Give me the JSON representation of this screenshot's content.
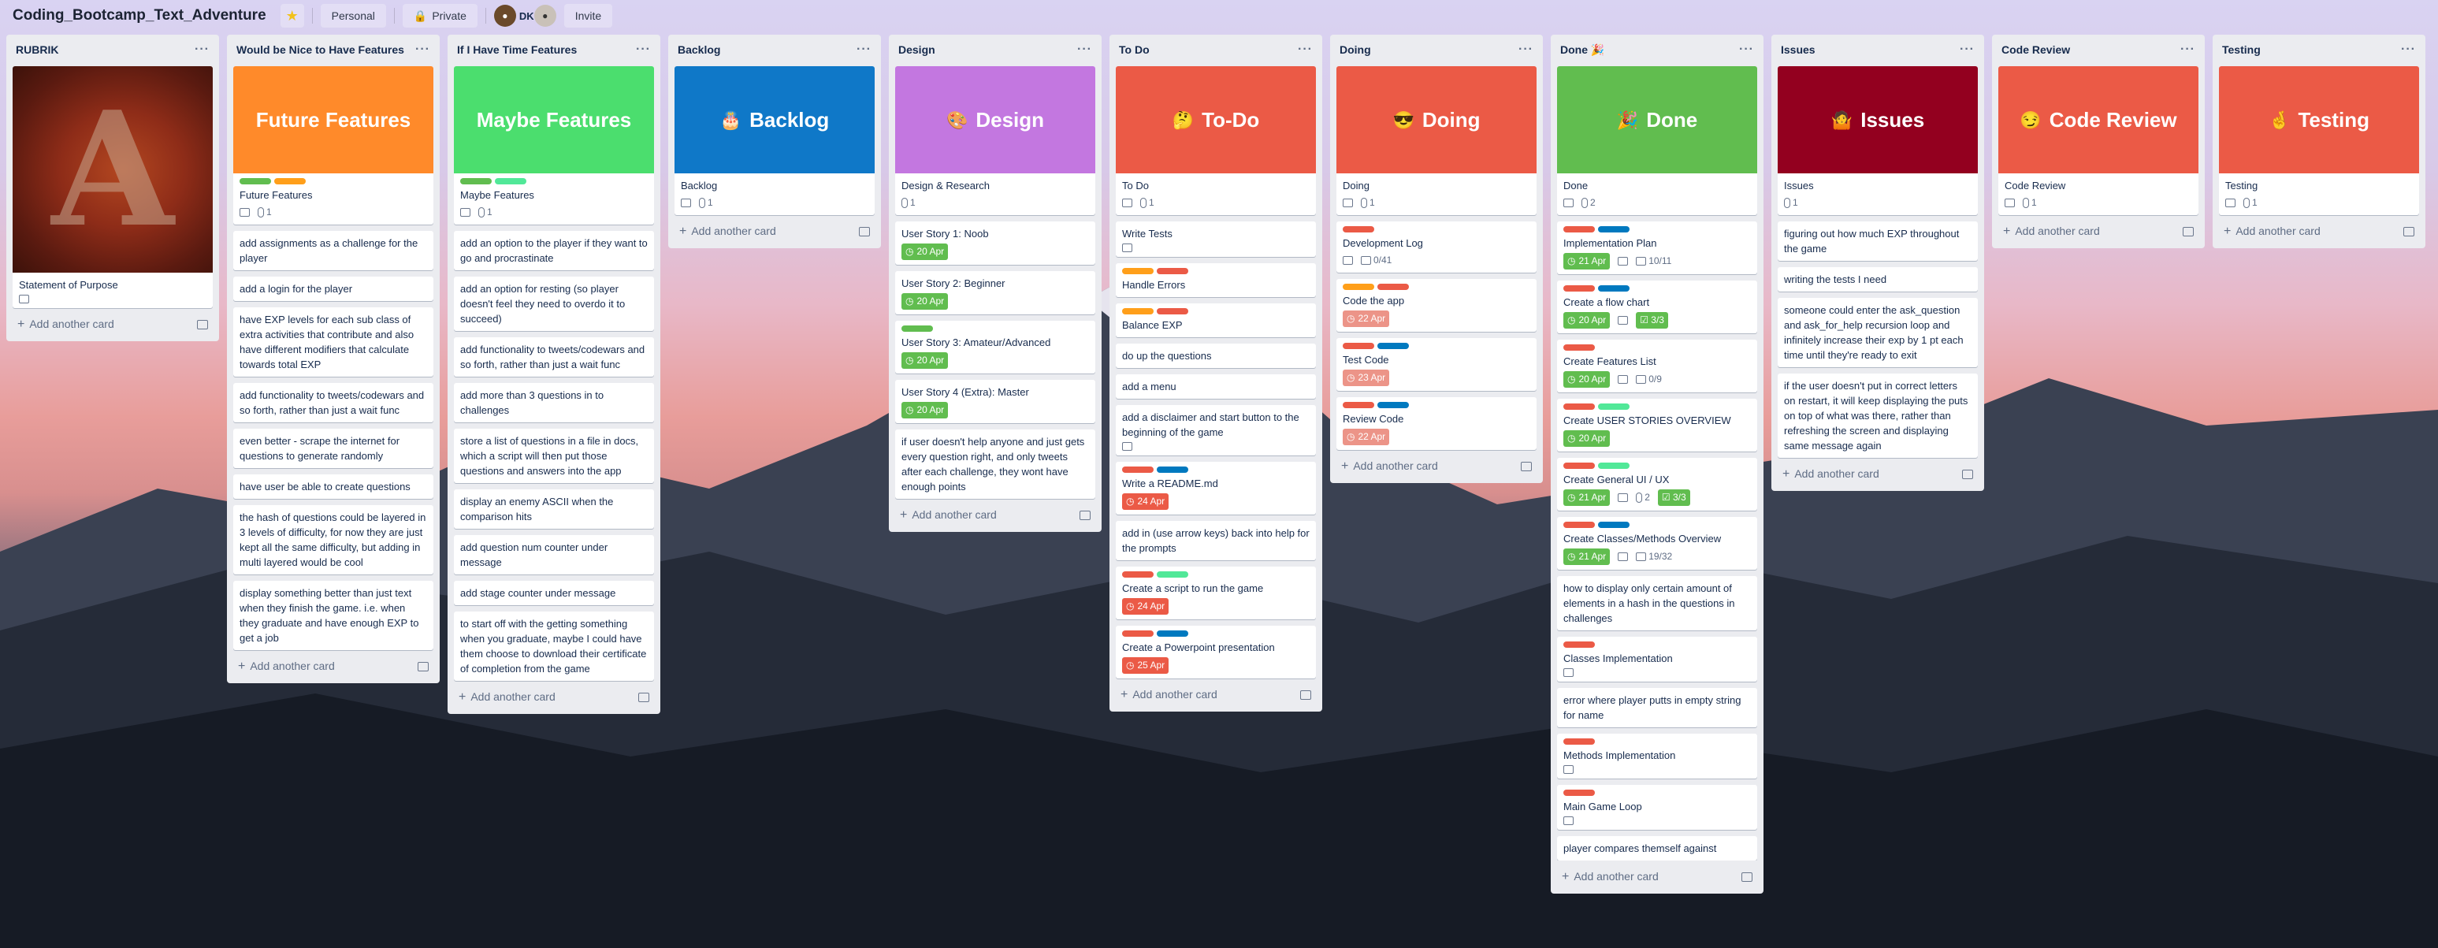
{
  "board": {
    "title": "Coding_Bootcamp_Text_Adventure",
    "visibility_team": "Personal",
    "visibility": "Private",
    "member_initials": "DK",
    "invite_label": "Invite"
  },
  "lists": {
    "rubrik": {
      "title": "RUBRIK",
      "add": "Add another card",
      "cards": {
        "c1": "Statement of Purpose"
      },
      "cover_letter": "A"
    },
    "nice": {
      "title": "Would be Nice to Have Features",
      "add": "Add another card",
      "cover": "Future Features",
      "cards": {
        "c1": "Future Features",
        "c1_att": "1",
        "c2": "add assignments as a challenge for the player",
        "c3": "add a login for the player",
        "c4": "have EXP levels for each sub class of extra activities that contribute and also have different modifiers that calculate towards total EXP",
        "c5": "add functionality to tweets/codewars and so forth, rather than just a wait func",
        "c6": "even better - scrape the internet for questions to generate randomly",
        "c7": "have user be able to create questions",
        "c8": "the hash of questions could be layered in 3 levels of difficulty, for now they are just kept all the same difficulty, but adding in multi layered would be cool",
        "c9": "display something better than just text when they finish the game. i.e. when they graduate and have enough EXP to get a job"
      }
    },
    "maybe": {
      "title": "If I Have Time Features",
      "add": "Add another card",
      "cover": "Maybe Features",
      "cards": {
        "c1": "Maybe Features",
        "c1_att": "1",
        "c2": "add an option to the player if they want to go and procrastinate",
        "c3": "add an option for resting (so player doesn't feel they need to overdo it to succeed)",
        "c4": "add functionality to tweets/codewars and so forth, rather than just a wait func",
        "c5": "add more than 3 questions in to challenges",
        "c6": "store a list of questions in a file in docs, which a script will then put those questions and answers into the app",
        "c7": "display an enemy ASCII when the comparison hits",
        "c8": "add question num counter under message",
        "c9": "add stage counter under message",
        "c10": "to start off with the getting something when you graduate, maybe I could have them choose to download their certificate of completion from the game"
      }
    },
    "backlog": {
      "title": "Backlog",
      "add": "Add another card",
      "cover": "Backlog",
      "cover_emoji": "🎂",
      "cards": {
        "c1": "Backlog",
        "c1_att": "1"
      }
    },
    "design": {
      "title": "Design",
      "add": "Add another card",
      "cover": "Design",
      "cover_emoji": "🎨",
      "cards": {
        "c1": "Design & Research",
        "c1_att": "1",
        "c2": "User Story 1: Noob",
        "c2_due": "20 Apr",
        "c3": "User Story 2: Beginner",
        "c3_due": "20 Apr",
        "c4": "User Story 3: Amateur/Advanced",
        "c4_due": "20 Apr",
        "c5": "User Story 4 (Extra): Master",
        "c5_due": "20 Apr",
        "c6": "if user doesn't help anyone and just gets every question right, and only tweets after each challenge, they wont have enough points"
      }
    },
    "todo": {
      "title": "To Do",
      "add": "Add another card",
      "cover": "To-Do",
      "cover_emoji": "🤔",
      "cards": {
        "c1": "To Do",
        "c1_att": "1",
        "c2": "Write Tests",
        "c3": "Handle Errors",
        "c4": "Balance EXP",
        "c5": "do up the questions",
        "c6": "add a menu",
        "c7": "add a disclaimer and start button to the beginning of the game",
        "c8": "Write a README.md",
        "c8_due": "24 Apr",
        "c9": "add in (use arrow keys) back into help for the prompts",
        "c10": "Create a script to run the game",
        "c10_due": "24 Apr",
        "c11": "Create a Powerpoint presentation",
        "c11_due": "25 Apr"
      }
    },
    "doing": {
      "title": "Doing",
      "add": "Add another card",
      "cover": "Doing",
      "cover_emoji": "😎",
      "cards": {
        "c1": "Doing",
        "c1_att": "1",
        "c2": "Development Log",
        "c2_check": "0/41",
        "c3": "Code the app",
        "c3_due": "22 Apr",
        "c4": "Test Code",
        "c4_due": "23 Apr",
        "c5": "Review Code",
        "c5_due": "22 Apr"
      }
    },
    "done": {
      "title": "Done 🎉",
      "add": "Add another card",
      "cover": "Done",
      "cover_emoji": "🎉",
      "cards": {
        "c1": "Done",
        "c1_att": "2",
        "c2": "Implementation Plan",
        "c2_due": "21 Apr",
        "c2_check": "10/11",
        "c3": "Create a flow chart",
        "c3_due": "20 Apr",
        "c3_check": "3/3",
        "c4": "Create Features List",
        "c4_due": "20 Apr",
        "c4_check": "0/9",
        "c5": "Create USER STORIES OVERVIEW",
        "c5_due": "20 Apr",
        "c6": "Create General UI / UX",
        "c6_due": "21 Apr",
        "c6_att": "2",
        "c6_check": "3/3",
        "c7": "Create Classes/Methods Overview",
        "c7_due": "21 Apr",
        "c7_check": "19/32",
        "c8": "how to display only certain amount of elements in a hash in the questions in challenges",
        "c9": "Classes Implementation",
        "c10": "error where player putts in empty string for name",
        "c11": "Methods Implementation",
        "c12": "Main Game Loop",
        "c13": "player compares themself against"
      }
    },
    "issues": {
      "title": "Issues",
      "add": "Add another card",
      "cover": "Issues",
      "cover_emoji": "🤷",
      "cards": {
        "c1": "Issues",
        "c1_att": "1",
        "c2": "figuring out how much EXP throughout the game",
        "c3": "writing the tests I need",
        "c4": "someone could enter the ask_question and ask_for_help recursion loop and infinitely increase their exp by 1 pt each time until they're ready to exit",
        "c5": "if the user doesn't put in correct letters on restart, it will keep displaying the puts on top of what was there, rather than refreshing the screen and displaying same message again"
      }
    },
    "review": {
      "title": "Code Review",
      "add": "Add another card",
      "cover": "Code Review",
      "cover_emoji": "😏",
      "cards": {
        "c1": "Code Review",
        "c1_att": "1"
      }
    },
    "testing": {
      "title": "Testing",
      "add": "Add another card",
      "cover": "Testing",
      "cover_emoji": "🤞",
      "cards": {
        "c1": "Testing",
        "c1_att": "1"
      }
    }
  },
  "colors": {
    "orange": "#ff8a2a",
    "green_cover": "#4bde6e",
    "blue": "#0f78c8",
    "purple": "#c377e0",
    "red": "#eb5a46",
    "green": "#61bd4f",
    "maroon": "#93001f",
    "label_green": "#61bd4f",
    "label_yellow": "#f2d600",
    "label_orange": "#ff9f1a",
    "label_red": "#eb5a46",
    "label_blue": "#0079bf",
    "label_lime": "#51e898"
  }
}
